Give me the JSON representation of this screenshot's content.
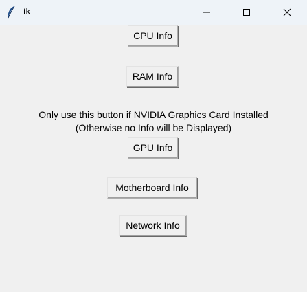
{
  "window": {
    "title": "tk",
    "app_icon": "feather-icon",
    "controls": {
      "minimize_icon": "minimize-icon",
      "maximize_icon": "maximize-icon",
      "close_icon": "close-icon"
    }
  },
  "buttons": {
    "cpu_label": "CPU Info",
    "ram_label": "RAM Info",
    "gpu_label": "GPU Info",
    "motherboard_label": "Motherboard Info",
    "network_label": "Network Info"
  },
  "gpu_note": {
    "line1": "Only use this button if NVIDIA Graphics Card Installed",
    "line2": "(Otherwise no Info will be Displayed)"
  },
  "colors": {
    "background": "#f0f0f0",
    "titlebar": "#eef3f8"
  }
}
